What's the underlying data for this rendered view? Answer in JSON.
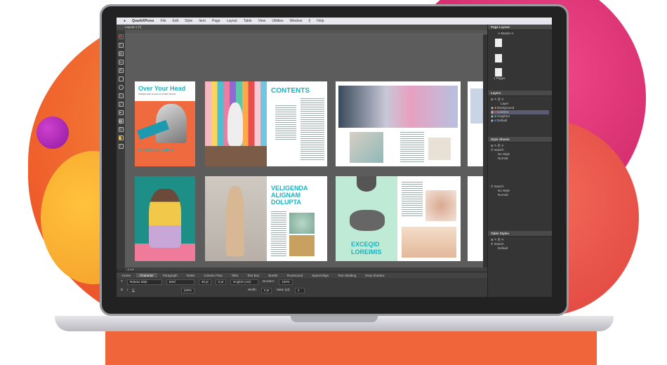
{
  "app": {
    "menu": [
      "QuarkXPress",
      "File",
      "Edit",
      "Style",
      "Item",
      "Page",
      "Layout",
      "Table",
      "View",
      "Utilities",
      "Window",
      "Help"
    ],
    "doc_tab": "Layout 1 (*)"
  },
  "spreads": {
    "p1_title": "Over Your Head",
    "p1_sub": "ORDER AND SCALE IN ALTER SPACE",
    "p1_caption": "A Featured article",
    "p2_heading": "CONTENTS",
    "p3_heading_line1": "VELIGENDA",
    "p3_heading_line2": "ALIGNAM",
    "p3_heading_line3": "DOLUPTA",
    "p4_heading_line1": "EXCEQID",
    "p4_heading_line2": "LOREIMIS"
  },
  "panels": {
    "page_layout": {
      "title": "Page Layout",
      "master": "A-Master-A",
      "page_label": "1 Pages"
    },
    "layers": {
      "title": "Layers",
      "items": [
        "Layer",
        "Background",
        "Content",
        "Graphics",
        "Default"
      ]
    },
    "style_sheets": {
      "title": "Style Sheets",
      "search": "Search",
      "para": [
        "No Style",
        "Normal"
      ],
      "char_search": "Search",
      "char": [
        "No Style",
        "Normal"
      ]
    },
    "table_styles": {
      "title": "Table Styles",
      "search": "Search",
      "items": [
        "Default"
      ]
    }
  },
  "measurements": {
    "tabs": [
      "Home",
      "Character",
      "Paragraph",
      "Rules",
      "Column Flow",
      "Tabs",
      "Text Box",
      "Border",
      "Runaround",
      "Space/Align",
      "Text Shading",
      "Drop Shadow"
    ],
    "font": "Roboto Slab",
    "style": "Bold",
    "size": "48 pt",
    "tracking": "0 pt",
    "scale": "100%",
    "lang": "English (US)",
    "border_label": "Borders:",
    "border_pct": "100%",
    "width_label": "Width:",
    "width_val": "0 pt",
    "value_label": "Value (pt):",
    "value_val": "4"
  },
  "colors": {
    "accent_teal": "#1bb3c0",
    "accent_orange": "#ef5a2a",
    "accent_pink": "#d12a6a"
  }
}
